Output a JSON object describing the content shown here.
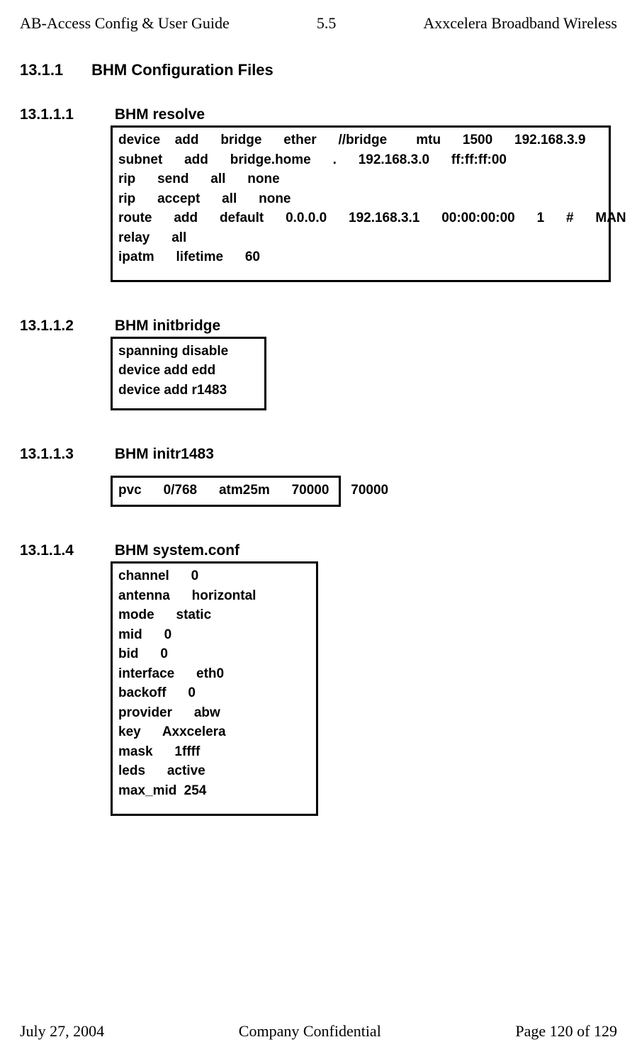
{
  "header": {
    "left": "AB-Access Config & User Guide",
    "center": "5.5",
    "right": "Axxcelera Broadband Wireless"
  },
  "section": {
    "num": "13.1.1",
    "title": "BHM Configuration Files"
  },
  "subs": {
    "s1": {
      "num": "13.1.1.1",
      "title": "BHM resolve",
      "code": "device  add   bridge   ether   //bridge    mtu   1500   192.168.3.9\nsubnet   add   bridge.home   .   192.168.3.0   ff:ff:ff:00\nrip   send   all   none\nrip   accept   all   none\nroute   add   default   0.0.0.0   192.168.3.1   00:00:00:00   1   #   MAN\nrelay   all\nipatm   lifetime   60"
    },
    "s2": {
      "num": "13.1.1.2",
      "title": "BHM initbridge",
      "code": "spanning disable\ndevice add edd\ndevice add r1483"
    },
    "s3": {
      "num": "13.1.1.3",
      "title": "BHM initr1483",
      "code": "pvc   0/768   atm25m   70000   70000"
    },
    "s4": {
      "num": "13.1.1.4",
      "title": "BHM system.conf",
      "code": "channel   0\nantenna   horizontal\nmode   static\nmid   0\nbid   0\ninterface   eth0\nbackoff   0\nprovider   abw\nkey   Axxcelera\nmask   1ffff\nleds   active\nmax_mid 254"
    }
  },
  "footer": {
    "left": "July 27, 2004",
    "center": "Company Confidential",
    "right": "Page 120 of 129"
  }
}
